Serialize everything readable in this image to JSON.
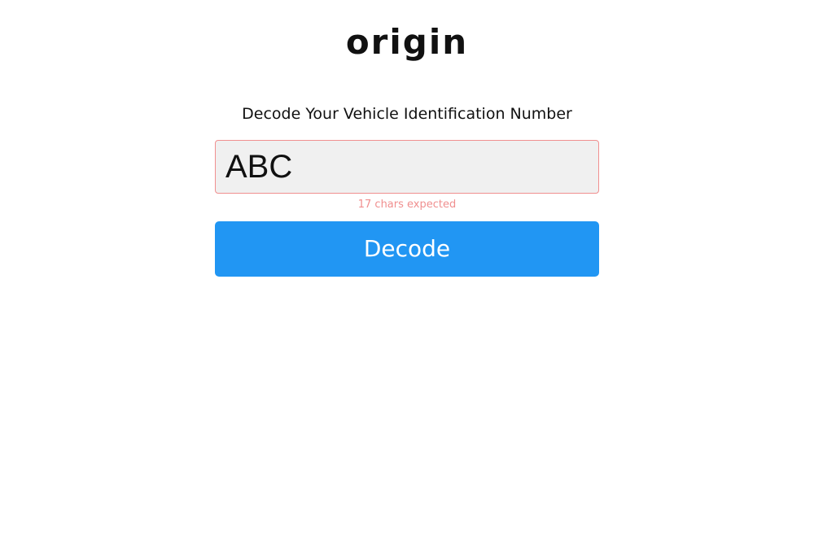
{
  "logo": {
    "text": "origin"
  },
  "form": {
    "heading": "Decode Your Vehicle Identification Number",
    "vin_input_value": "ABC",
    "vin_input_placeholder": "",
    "error_message": "17 chars expected",
    "decode_button_label": "Decode"
  },
  "colors": {
    "accent": "#2196f3",
    "error": "#f08f8f",
    "input_background": "#f0f0f0",
    "text": "#111111"
  }
}
